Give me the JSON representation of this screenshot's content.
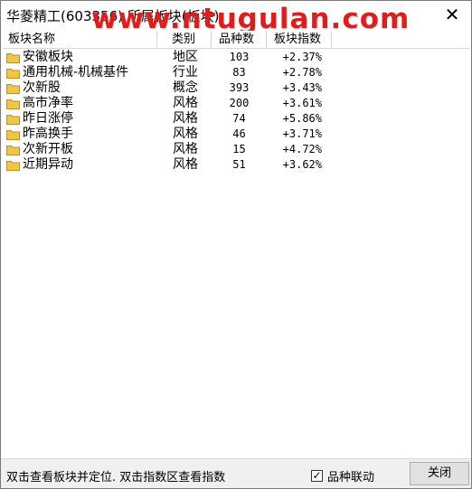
{
  "window": {
    "title": "华菱精工(603356) 所属板块(板块)",
    "watermark": "www.ntugulan.com",
    "close_glyph": "✕"
  },
  "columns": {
    "name": "板块名称",
    "category": "类别",
    "count": "品种数",
    "index": "板块指数"
  },
  "rows": [
    {
      "name": "安徽板块",
      "category": "地区",
      "count": "103",
      "index": "+2.37%",
      "icon": "folder-icon"
    },
    {
      "name": "通用机械-机械基件",
      "category": "行业",
      "count": "83",
      "index": "+2.78%",
      "icon": "folder-icon"
    },
    {
      "name": "次新股",
      "category": "概念",
      "count": "393",
      "index": "+3.43%",
      "icon": "folder-icon"
    },
    {
      "name": "高市净率",
      "category": "风格",
      "count": "200",
      "index": "+3.61%",
      "icon": "folder-icon"
    },
    {
      "name": "昨日涨停",
      "category": "风格",
      "count": "74",
      "index": "+5.86%",
      "icon": "folder-icon"
    },
    {
      "name": "昨高换手",
      "category": "风格",
      "count": "46",
      "index": "+3.71%",
      "icon": "folder-icon"
    },
    {
      "name": "次新开板",
      "category": "风格",
      "count": "15",
      "index": "+4.72%",
      "icon": "folder-icon"
    },
    {
      "name": "近期异动",
      "category": "风格",
      "count": "51",
      "index": "+3.62%",
      "icon": "folder-icon"
    }
  ],
  "status": {
    "hint": "双击查看板块并定位. 双击指数区查看指数",
    "linkage_label": "品种联动",
    "linkage_checked": true,
    "check_glyph": "✓",
    "close_button": "关闭"
  },
  "colors": {
    "watermark": "#e21b1b",
    "folder": "#f5c542"
  }
}
